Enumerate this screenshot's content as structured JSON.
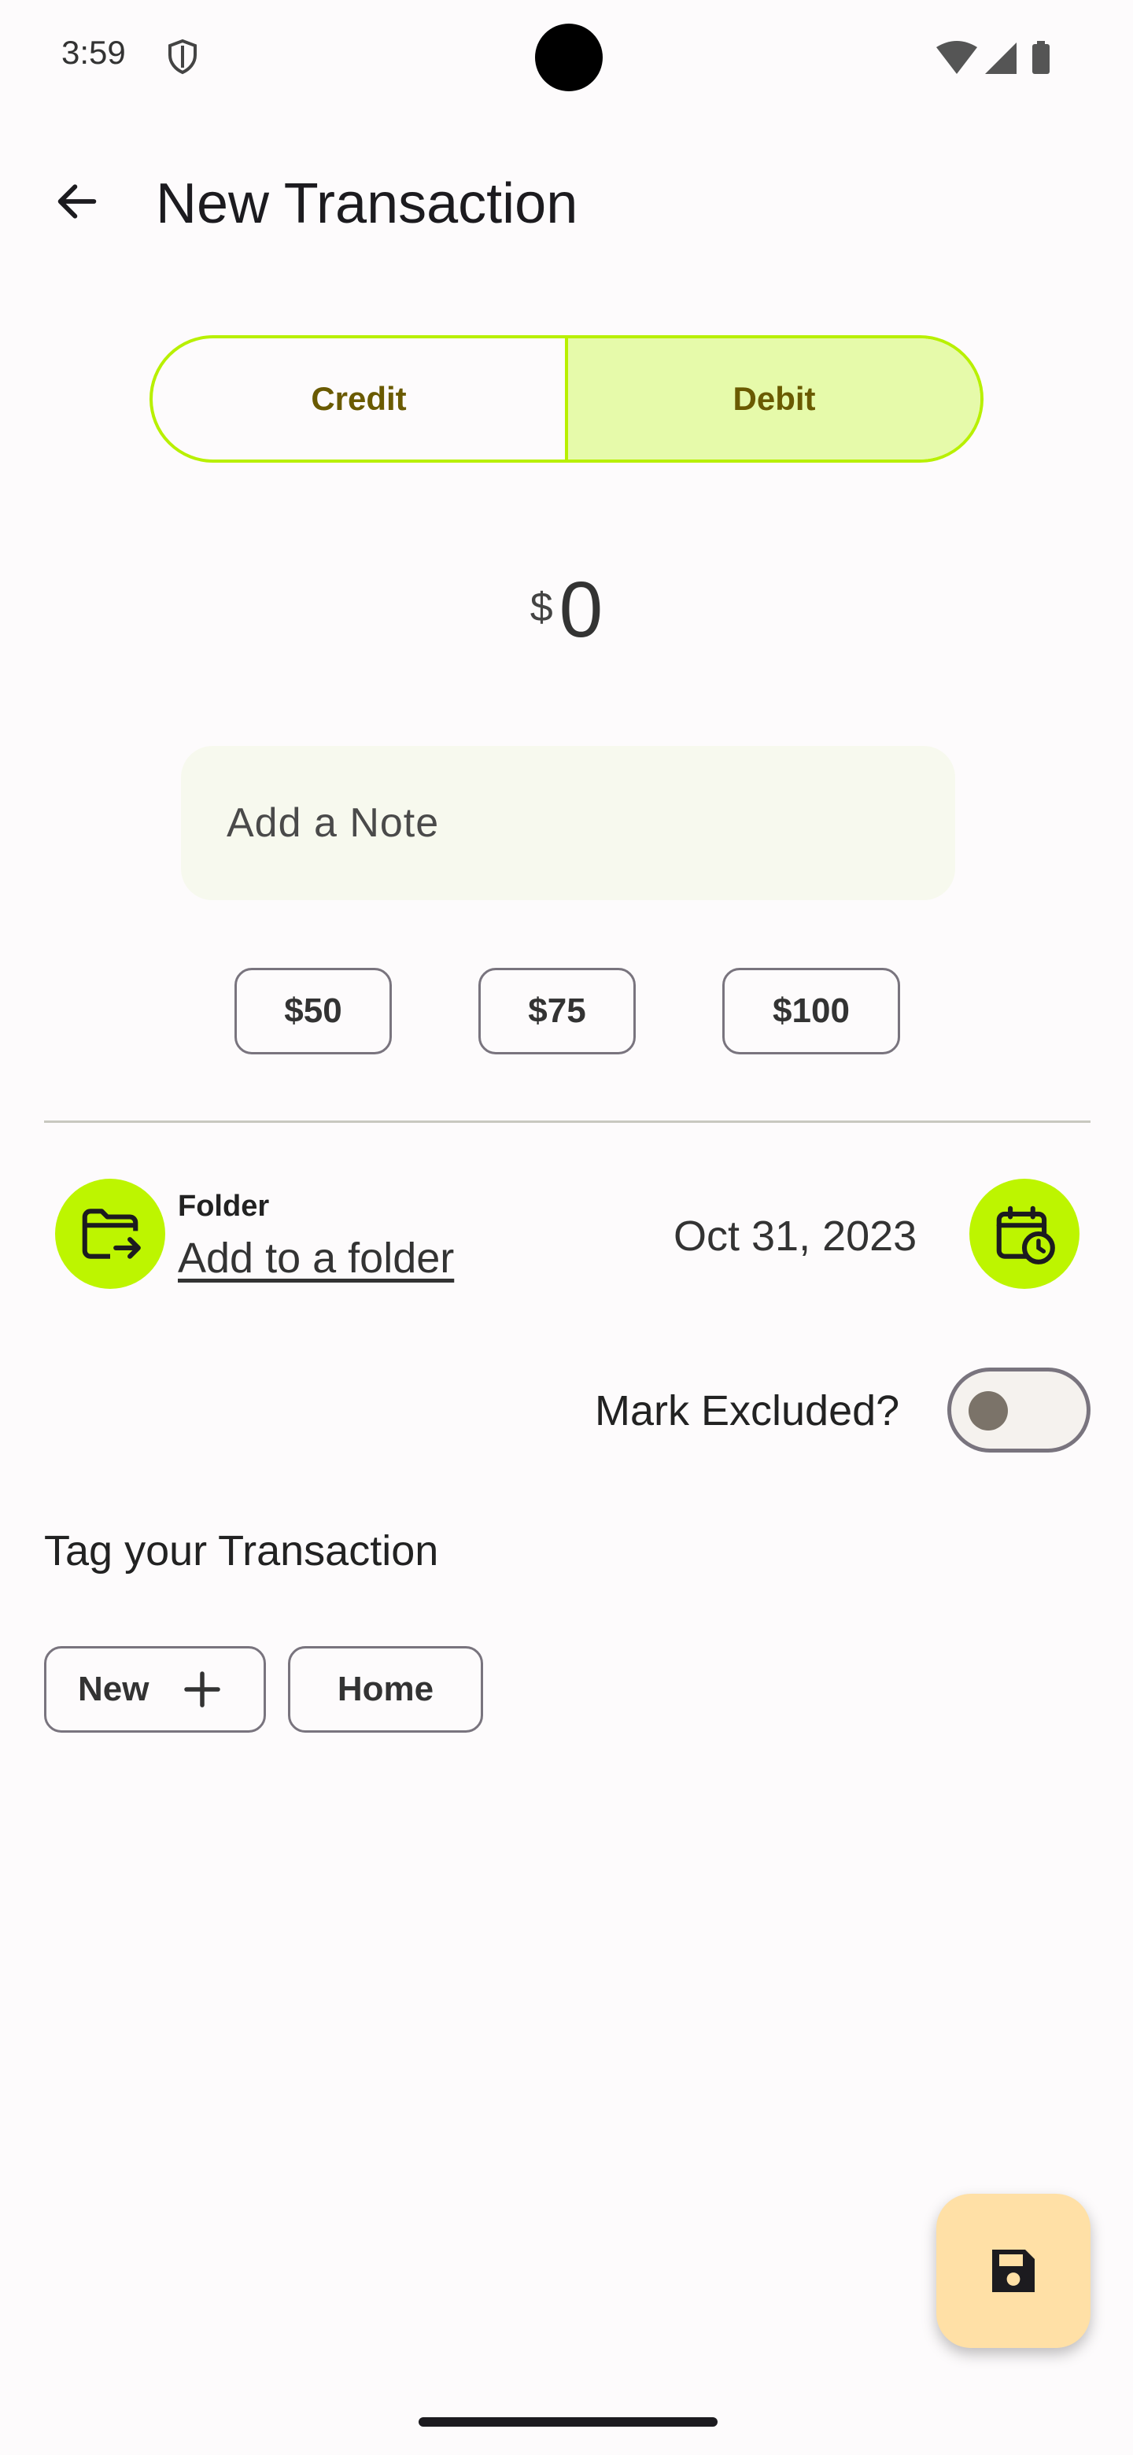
{
  "status_bar": {
    "time": "3:59",
    "icons": [
      "shield-icon",
      "wifi-icon",
      "signal-icon",
      "battery-icon"
    ]
  },
  "app_bar": {
    "title": "New Transaction",
    "back_icon": "arrow-back-icon"
  },
  "transaction_type": {
    "options": [
      {
        "label": "Credit",
        "selected": false
      },
      {
        "label": "Debit",
        "selected": true
      }
    ]
  },
  "amount": {
    "currency": "$",
    "value": "0"
  },
  "note": {
    "placeholder": "Add a Note",
    "value": ""
  },
  "quick_amounts": [
    "$50",
    "$75",
    "$100"
  ],
  "folder": {
    "label": "Folder",
    "link": "Add to a folder",
    "icon": "folder-move-icon"
  },
  "date": {
    "value": "Oct 31, 2023",
    "icon": "calendar-clock-icon"
  },
  "excluded": {
    "label": "Mark Excluded?",
    "checked": false
  },
  "tags": {
    "title": "Tag your Transaction",
    "new_label": "New",
    "items": [
      "Home"
    ]
  },
  "fab": {
    "icon": "save-icon"
  },
  "colors": {
    "accent": "#BDF500",
    "segment_border": "#B8F000",
    "segment_selected": "#E6FAAA",
    "segment_text": "#6A5A00",
    "fab": "#FFE0A6",
    "background": "#FDFBFC"
  }
}
